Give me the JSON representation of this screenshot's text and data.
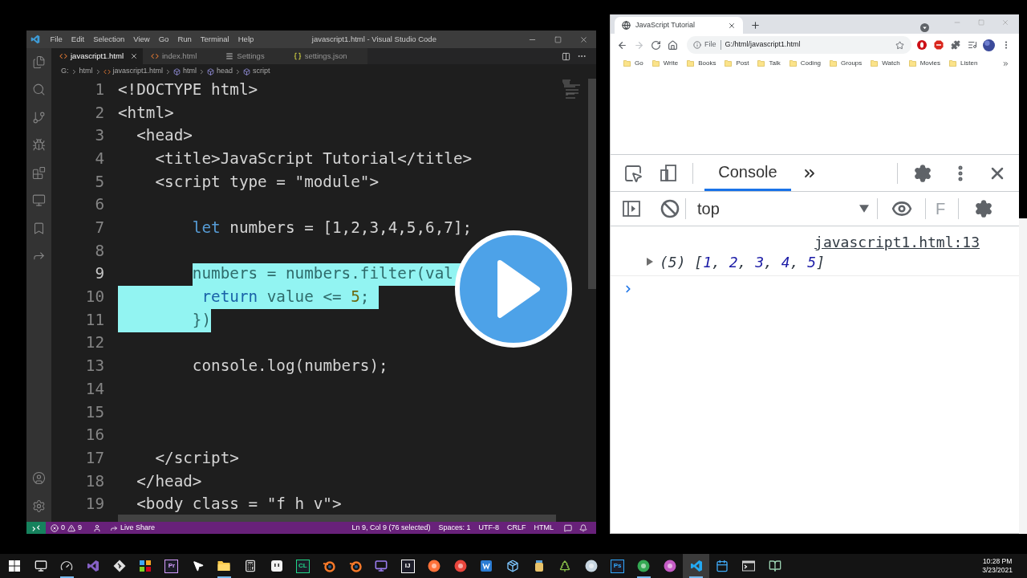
{
  "vscode": {
    "menu": [
      "File",
      "Edit",
      "Selection",
      "View",
      "Go",
      "Run",
      "Terminal",
      "Help"
    ],
    "title": "javascript1.html - Visual Studio Code",
    "tabs": [
      {
        "label": "javascript1.html",
        "kind": "html",
        "selected": true
      },
      {
        "label": "index.html",
        "kind": "html",
        "selected": false
      },
      {
        "label": "Settings",
        "kind": "settings",
        "selected": false
      },
      {
        "label": "settings.json",
        "kind": "json",
        "selected": false
      }
    ],
    "breadcrumb": [
      {
        "label": "G:",
        "kind": "folder"
      },
      {
        "label": "html",
        "kind": "folder"
      },
      {
        "label": "javascript1.html",
        "kind": "file"
      },
      {
        "label": "html",
        "kind": "element"
      },
      {
        "label": "head",
        "kind": "element"
      },
      {
        "label": "script",
        "kind": "element"
      }
    ],
    "code_lines": [
      {
        "number": "1",
        "active": false,
        "tokens": [
          {
            "text": "<!DOCTYPE html>",
            "kind": "plain",
            "selected": false
          }
        ]
      },
      {
        "number": "2",
        "active": false,
        "tokens": [
          {
            "text": "<html>",
            "kind": "plain",
            "selected": false
          }
        ]
      },
      {
        "number": "3",
        "active": false,
        "tokens": [
          {
            "text": "  <head>",
            "kind": "plain",
            "selected": false
          }
        ]
      },
      {
        "number": "4",
        "active": false,
        "tokens": [
          {
            "text": "    <title>JavaScript Tutorial</title>",
            "kind": "plain",
            "selected": false
          }
        ]
      },
      {
        "number": "5",
        "active": false,
        "tokens": [
          {
            "text": "    <script type = \"module\">",
            "kind": "plain",
            "selected": false
          }
        ]
      },
      {
        "number": "6",
        "active": false
      },
      {
        "number": "7",
        "active": false,
        "tokens": [
          {
            "text": "        let",
            "kind": "keyword",
            "selected": false
          },
          {
            "text": " numbers = [1,2,3,4,5,6,7];",
            "kind": "plain",
            "selected": false
          }
        ]
      },
      {
        "number": "8",
        "active": false
      },
      {
        "number": "9",
        "active": true,
        "tokens": [
          {
            "text": "        numbers = numbers.filter(val",
            "kind": "plain",
            "selected": true
          }
        ]
      },
      {
        "number": "10",
        "active": false,
        "tokens": [
          {
            "text": "         return",
            "kind": "keyword",
            "selected": true
          },
          {
            "text": " value <= ",
            "kind": "plain",
            "selected": true
          },
          {
            "text": "5",
            "kind": "number",
            "selected": true
          },
          {
            "text": ";",
            "kind": "plain",
            "selected": true
          }
        ]
      },
      {
        "number": "11",
        "active": false,
        "tokens": [
          {
            "text": "        })",
            "kind": "plain",
            "selected": true
          }
        ]
      },
      {
        "number": "12",
        "active": false
      },
      {
        "number": "13",
        "active": false,
        "tokens": [
          {
            "text": "        console.log(numbers);",
            "kind": "plain",
            "selected": false
          }
        ]
      },
      {
        "number": "14",
        "active": false
      },
      {
        "number": "15",
        "active": false
      },
      {
        "number": "16",
        "active": false
      },
      {
        "number": "17",
        "active": false,
        "tokens": [
          {
            "text": "    </script>",
            "kind": "plain",
            "selected": false
          }
        ]
      },
      {
        "number": "18",
        "active": false,
        "tokens": [
          {
            "text": "  </head>",
            "kind": "plain",
            "selected": false
          }
        ]
      },
      {
        "number": "19",
        "active": false,
        "tokens": [
          {
            "text": "  <body class = \"f h v\">",
            "kind": "plain",
            "selected": false
          }
        ]
      }
    ],
    "status_bar": {
      "errors": "0",
      "warnings": "9",
      "live_share": "Live Share",
      "cursor": "Ln 9, Col 9 (76 selected)",
      "indentation": "Spaces: 1",
      "encoding": "UTF-8",
      "line_ending": "CRLF",
      "language": "HTML"
    }
  },
  "browser": {
    "tabs": [
      {
        "title": "JavaScript Tutorial",
        "selected": true
      }
    ],
    "nav_buttons": [
      {
        "kind": "back",
        "disabled": false
      },
      {
        "kind": "forward",
        "disabled": true
      },
      {
        "kind": "reload",
        "disabled": false
      },
      {
        "kind": "home",
        "disabled": false
      }
    ],
    "address": {
      "scheme": "File",
      "url": "G:/html/javascript1.html"
    },
    "bookmarks": [
      "Go",
      "Write",
      "Books",
      "Post",
      "Talk",
      "Coding",
      "Groups",
      "Watch",
      "Movies",
      "Listen"
    ],
    "devtools": {
      "tabs": [
        {
          "label": "Console",
          "selected": true
        }
      ],
      "context": "top",
      "filter_placeholder": "F",
      "messages": [
        {
          "source": "javascript1.html:13",
          "expanded": false,
          "tokens": [
            {
              "text": "(5) [",
              "kind": "plain"
            },
            {
              "text": "1",
              "kind": "number"
            },
            {
              "text": ", ",
              "kind": "plain"
            },
            {
              "text": "2",
              "kind": "number"
            },
            {
              "text": ", ",
              "kind": "plain"
            },
            {
              "text": "3",
              "kind": "number"
            },
            {
              "text": ", ",
              "kind": "plain"
            },
            {
              "text": "4",
              "kind": "number"
            },
            {
              "text": ", ",
              "kind": "plain"
            },
            {
              "text": "5",
              "kind": "number"
            },
            {
              "text": "]",
              "kind": "plain"
            }
          ]
        }
      ]
    }
  },
  "taskbar": {
    "apps": [
      {
        "kind": "windows",
        "running": false,
        "selected": false
      },
      {
        "kind": "monitor",
        "running": false,
        "selected": false
      },
      {
        "kind": "dial",
        "running": true,
        "selected": false
      },
      {
        "kind": "ribbon",
        "color": "#8661c5",
        "running": false,
        "selected": false
      },
      {
        "kind": "diamond",
        "running": false,
        "selected": false
      },
      {
        "kind": "blocks",
        "running": false,
        "selected": false
      },
      {
        "kind": "label",
        "label": "Pr",
        "color": "#d59dff",
        "running": false,
        "selected": false
      },
      {
        "kind": "cursor",
        "running": false,
        "selected": false
      },
      {
        "kind": "folder",
        "running": true,
        "selected": false
      },
      {
        "kind": "calculator",
        "running": false,
        "selected": false
      },
      {
        "kind": "face",
        "running": false,
        "selected": false
      },
      {
        "kind": "label",
        "label": "CL",
        "color": "#21d789",
        "running": false,
        "selected": false
      },
      {
        "kind": "swirl",
        "running": false,
        "selected": false
      },
      {
        "kind": "swirl",
        "running": false,
        "selected": false
      },
      {
        "kind": "display",
        "running": false,
        "selected": false
      },
      {
        "kind": "label",
        "label": "IJ",
        "color": "#ffffff",
        "running": false,
        "selected": false
      },
      {
        "kind": "orb",
        "color": "#ff7139",
        "running": false,
        "selected": false
      },
      {
        "kind": "orb",
        "color": "#e8453c",
        "running": false,
        "selected": false
      },
      {
        "kind": "tile",
        "color": "#2b7cd3",
        "running": false,
        "selected": false
      },
      {
        "kind": "box",
        "running": false,
        "selected": false
      },
      {
        "kind": "jar",
        "running": false,
        "selected": false
      },
      {
        "kind": "tree",
        "running": false,
        "selected": false
      },
      {
        "kind": "orb",
        "color": "#c7d5e0",
        "running": false,
        "selected": false
      },
      {
        "kind": "label",
        "label": "Ps",
        "color": "#31a8ff",
        "running": false,
        "selected": false
      },
      {
        "kind": "orb",
        "color": "#34a853",
        "running": true,
        "selected": false
      },
      {
        "kind": "orb",
        "color": "#c45bc4",
        "running": false,
        "selected": false
      },
      {
        "kind": "ribbon",
        "color": "#23a9f2",
        "running": true,
        "selected": true
      },
      {
        "kind": "calendar",
        "running": false,
        "selected": false
      },
      {
        "kind": "terminal",
        "running": false,
        "selected": false
      },
      {
        "kind": "notebook",
        "running": false,
        "selected": false
      }
    ],
    "clock": {
      "time": "10:28 PM",
      "date": "3/23/2021"
    }
  }
}
